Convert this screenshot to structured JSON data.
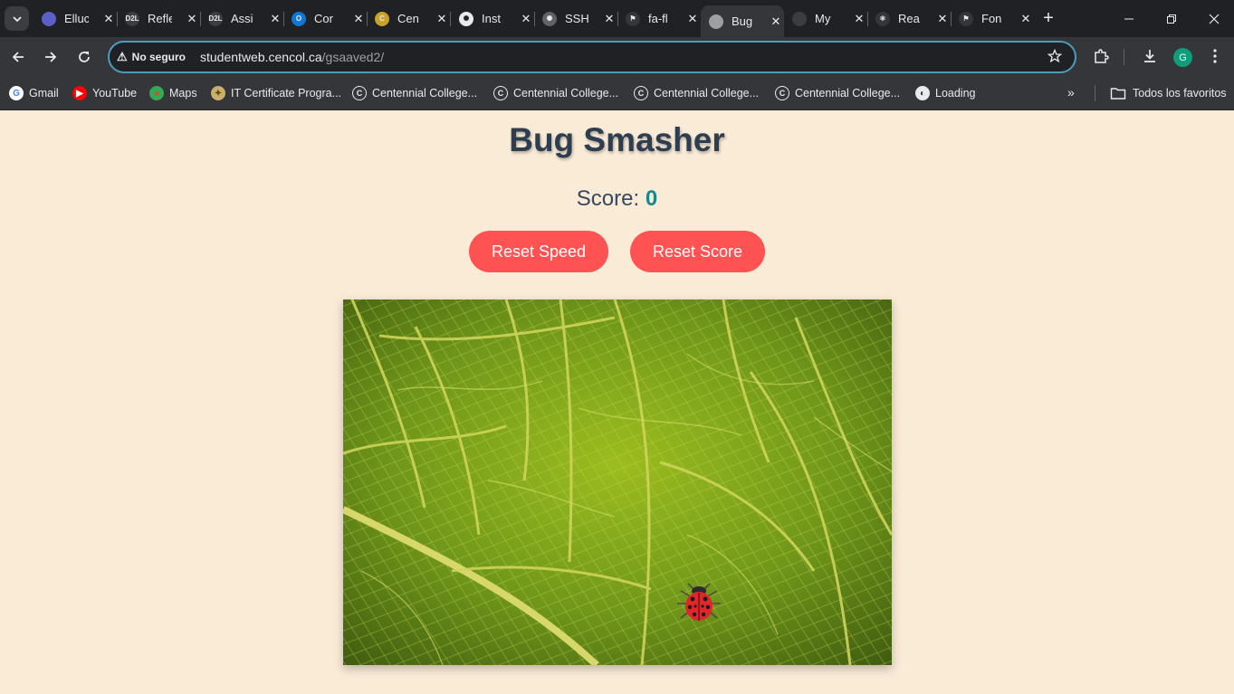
{
  "browser": {
    "tabs": [
      {
        "title": "Ellucian",
        "favicon": "ellucian-icon",
        "color": "#5b5fc7",
        "glyph": ""
      },
      {
        "title": "Reflection",
        "favicon": "d2l-icon",
        "color": "#3c3d41",
        "glyph": "D2L"
      },
      {
        "title": "Assignment",
        "favicon": "d2l-icon",
        "color": "#3c3d41",
        "glyph": "D2L"
      },
      {
        "title": "Correo",
        "favicon": "outlook-icon",
        "color": "#0f78d4",
        "glyph": "O"
      },
      {
        "title": "Centennial",
        "favicon": "centennial-icon",
        "color": "#c9a227",
        "glyph": "C"
      },
      {
        "title": "Instructions",
        "favicon": "openai-icon",
        "color": "#e8eaed",
        "glyph": "✺"
      },
      {
        "title": "SSH",
        "favicon": "openai-icon",
        "color": "#5f6368",
        "glyph": "✺"
      },
      {
        "title": "fa-flag",
        "favicon": "flag-icon",
        "color": "#35363a",
        "glyph": "⚑"
      },
      {
        "title": "Bug Smasher",
        "favicon": "globe-icon",
        "color": "#9aa0a6",
        "glyph": "",
        "active": true
      },
      {
        "title": "MyGitHub",
        "favicon": "github-icon",
        "color": "#3c3d41",
        "glyph": ""
      },
      {
        "title": "React",
        "favicon": "react-icon",
        "color": "#35363a",
        "glyph": "⚛"
      },
      {
        "title": "Font Awesome",
        "favicon": "flag-icon",
        "color": "#35363a",
        "glyph": "⚑"
      }
    ],
    "tab_titles_visible": [
      "Elluc",
      "Refle",
      "Assi",
      "Cor",
      "Cen",
      "Inst",
      "SSH",
      "fa-fl",
      "Bug",
      "My",
      "Rea",
      "Fon"
    ],
    "omnibox": {
      "security_label": "No seguro",
      "host": "studentweb.cencol.ca",
      "path": "/gsaaved2/"
    },
    "profile_initial": "G",
    "bookmarks": [
      {
        "label": "Gmail",
        "icon": "google-icon",
        "color": "#ffffff",
        "glyph": "G",
        "glyph_color": "#4285f4"
      },
      {
        "label": "YouTube",
        "icon": "youtube-icon",
        "color": "#ff0000",
        "glyph": "▶",
        "glyph_color": "#ffffff"
      },
      {
        "label": "Maps",
        "icon": "maps-icon",
        "color": "#34a853",
        "glyph": "●",
        "glyph_color": "#ea4335"
      },
      {
        "label": "IT Certificate Progra...",
        "icon": "certificate-icon",
        "color": "#c9b06b",
        "glyph": "✦",
        "glyph_color": "#5a4a1a"
      },
      {
        "label": "Centennial College...",
        "icon": "centennial-icon",
        "color": "#35363a",
        "glyph": "C",
        "glyph_color": "#e8eaed"
      },
      {
        "label": "Centennial College...",
        "icon": "centennial-icon",
        "color": "#35363a",
        "glyph": "C",
        "glyph_color": "#e8eaed"
      },
      {
        "label": "Centennial College...",
        "icon": "centennial-icon",
        "color": "#35363a",
        "glyph": "C",
        "glyph_color": "#e8eaed"
      },
      {
        "label": "Centennial College...",
        "icon": "centennial-icon",
        "color": "#35363a",
        "glyph": "C",
        "glyph_color": "#e8eaed"
      },
      {
        "label": "Loading",
        "icon": "globe-icon",
        "color": "#e8eaed",
        "glyph": "◐",
        "glyph_color": "#35363a"
      }
    ],
    "all_bookmarks_label": "Todos los favoritos"
  },
  "page": {
    "title": "Bug Smasher",
    "score_label": "Score:",
    "score_value": "0",
    "reset_speed_label": "Reset Speed",
    "reset_score_label": "Reset Score",
    "game_background": "green-leaf-image",
    "bug": "ladybug-icon"
  },
  "colors": {
    "page_background": "#faebd7",
    "button": "#ff5252",
    "score_value": "#17868d",
    "heading": "#2c3e50"
  }
}
